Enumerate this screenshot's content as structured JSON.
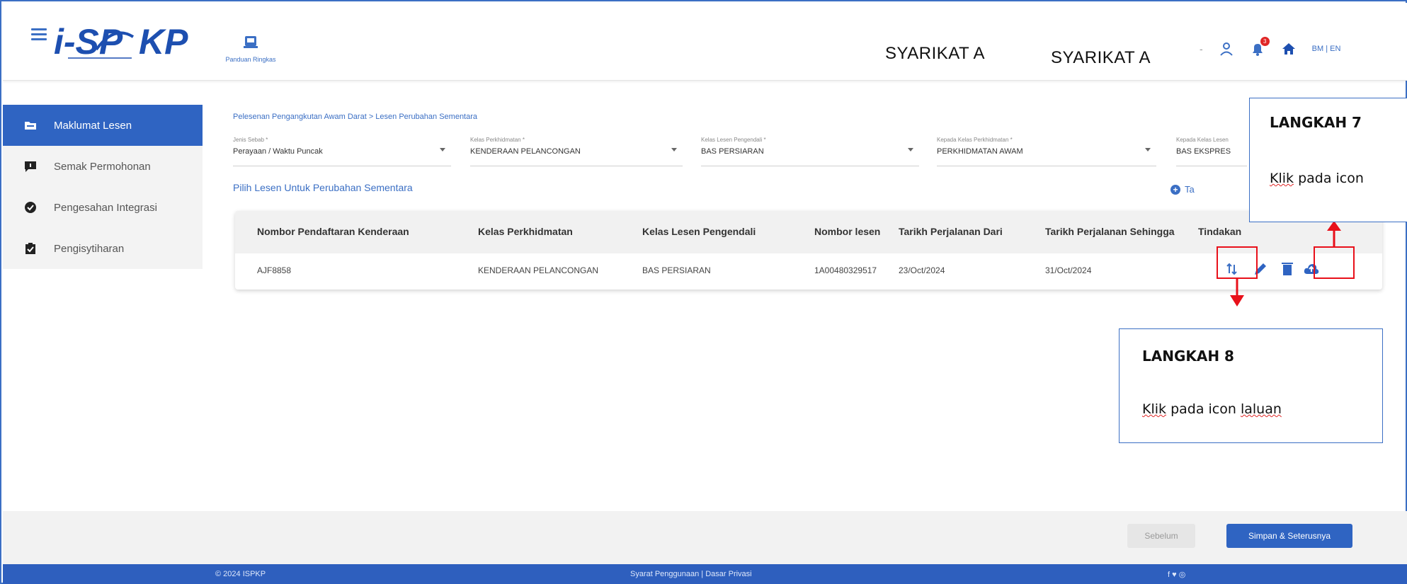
{
  "header": {
    "logo_text": "i-SPKP",
    "guide_label": "Panduan Ringkas",
    "company_1": "SYARIKAT A",
    "company_2": "SYARIKAT A",
    "separator": "-",
    "notification_count": "3",
    "lang_label": "BM | EN",
    "brand_color": "#2f64c2"
  },
  "sidebar": {
    "items": [
      {
        "label": "Maklumat Lesen",
        "icon": "folder-icon",
        "active": true
      },
      {
        "label": "Semak Permohonan",
        "icon": "chat-icon",
        "active": false
      },
      {
        "label": "Pengesahan Integrasi",
        "icon": "check-badge-icon",
        "active": false
      },
      {
        "label": "Pengisytiharan",
        "icon": "clipboard-icon",
        "active": false
      }
    ]
  },
  "breadcrumb": "Pelesenan Pengangkutan Awam Darat > Lesen Perubahan Sementara",
  "filters": [
    {
      "label": "Jenis Sebab *",
      "value": "Perayaan / Waktu Puncak"
    },
    {
      "label": "Kelas Perkhidmatan *",
      "value": "KENDERAAN PELANCONGAN"
    },
    {
      "label": "Kelas Lesen Pengendali *",
      "value": "BAS PERSIARAN"
    },
    {
      "label": "Kepada Kelas Perkhidmatan *",
      "value": "PERKHIDMATAN AWAM"
    },
    {
      "label": "Kepada Kelas Lesen",
      "value": "BAS EKSPRES"
    }
  ],
  "section_title": "Pilih Lesen Untuk Perubahan Sementara",
  "add_link": "Ta",
  "table": {
    "headers": [
      "Nombor Pendaftaran Kenderaan",
      "Kelas Perkhidmatan",
      "Kelas Lesen Pengendali",
      "Nombor lesen",
      "Tarikh Perjalanan Dari",
      "Tarikh Perjalanan Sehingga",
      "Tindakan"
    ],
    "rows": [
      [
        "AJF8858",
        "KENDERAAN PELANCONGAN",
        "BAS PERSIARAN",
        "1A00480329517",
        "23/Oct/2024",
        "31/Oct/2024"
      ]
    ],
    "actions": [
      "route-icon",
      "edit-icon",
      "delete-icon",
      "cloud-upload-icon"
    ]
  },
  "callouts": {
    "step7": {
      "title": "LANGKAH 7",
      "text_pre": "",
      "text_word": "Klik",
      "text_post": " pada icon"
    },
    "step8": {
      "title": "LANGKAH 8",
      "text_word": "Klik",
      "text_mid": " pada icon ",
      "text_word2": "laluan"
    }
  },
  "buttons": {
    "prev": "Sebelum",
    "next": "Simpan & Seterusnya"
  },
  "footer": {
    "copyright": "© 2024 ISPKP",
    "links": "Syarat Penggunaan | Dasar Privasi",
    "social": "f ♥ ◎"
  },
  "colors": {
    "primary": "#2f64c2",
    "highlight_red": "#e8101a"
  }
}
